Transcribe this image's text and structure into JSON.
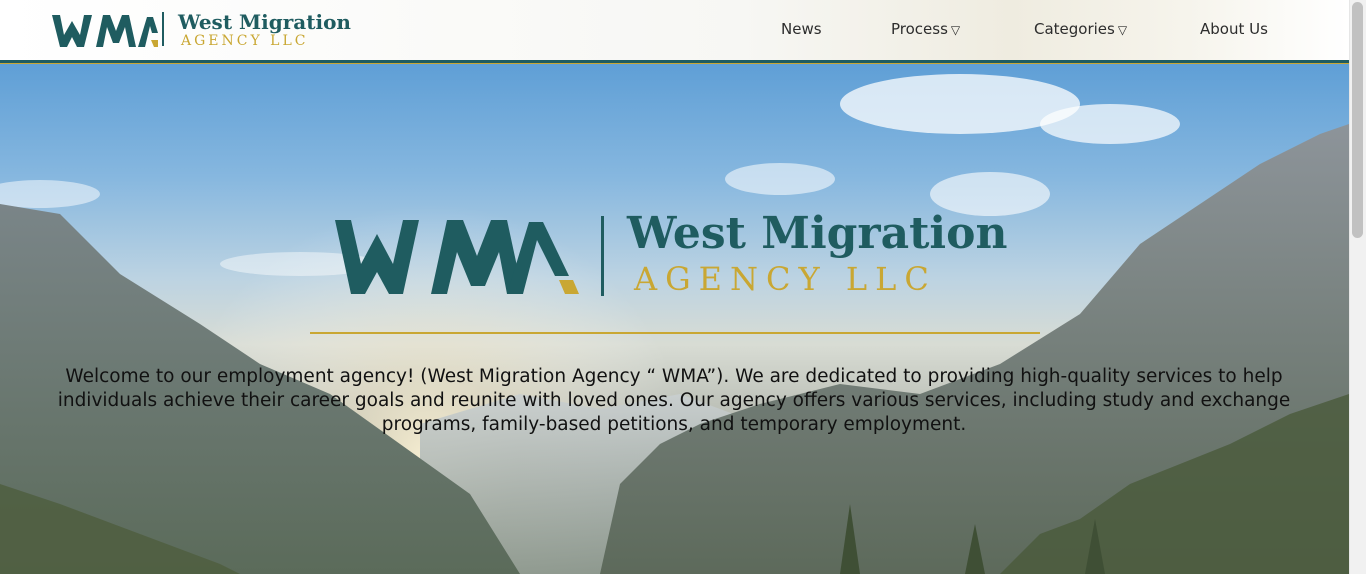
{
  "header": {
    "logo": {
      "marks": "WMA",
      "name": "West Migration",
      "sub": "AGENCY LLC"
    },
    "nav": [
      {
        "label": "News",
        "has_dropdown": false
      },
      {
        "label": "Process",
        "has_dropdown": true,
        "arrow": "▽"
      },
      {
        "label": "Categories",
        "has_dropdown": true,
        "arrow": "▽"
      },
      {
        "label": "About Us",
        "has_dropdown": false
      }
    ]
  },
  "hero": {
    "logo": {
      "marks": "WMA",
      "name": "West Migration",
      "sub": "AGENCY LLC"
    },
    "welcome_text": "Welcome to our employment agency! (West Migration Agency “ WMA”). We are dedicated to providing high-quality services to help individuals achieve their career goals and reunite with loved ones. Our agency offers various services, including study and exchange programs, family-based petitions, and temporary employment."
  },
  "colors": {
    "brand_teal": "#1f5c60",
    "brand_gold": "#c9a733",
    "text": "#111111"
  },
  "icons": {
    "dropdown": "triangle-down-outline-icon"
  }
}
